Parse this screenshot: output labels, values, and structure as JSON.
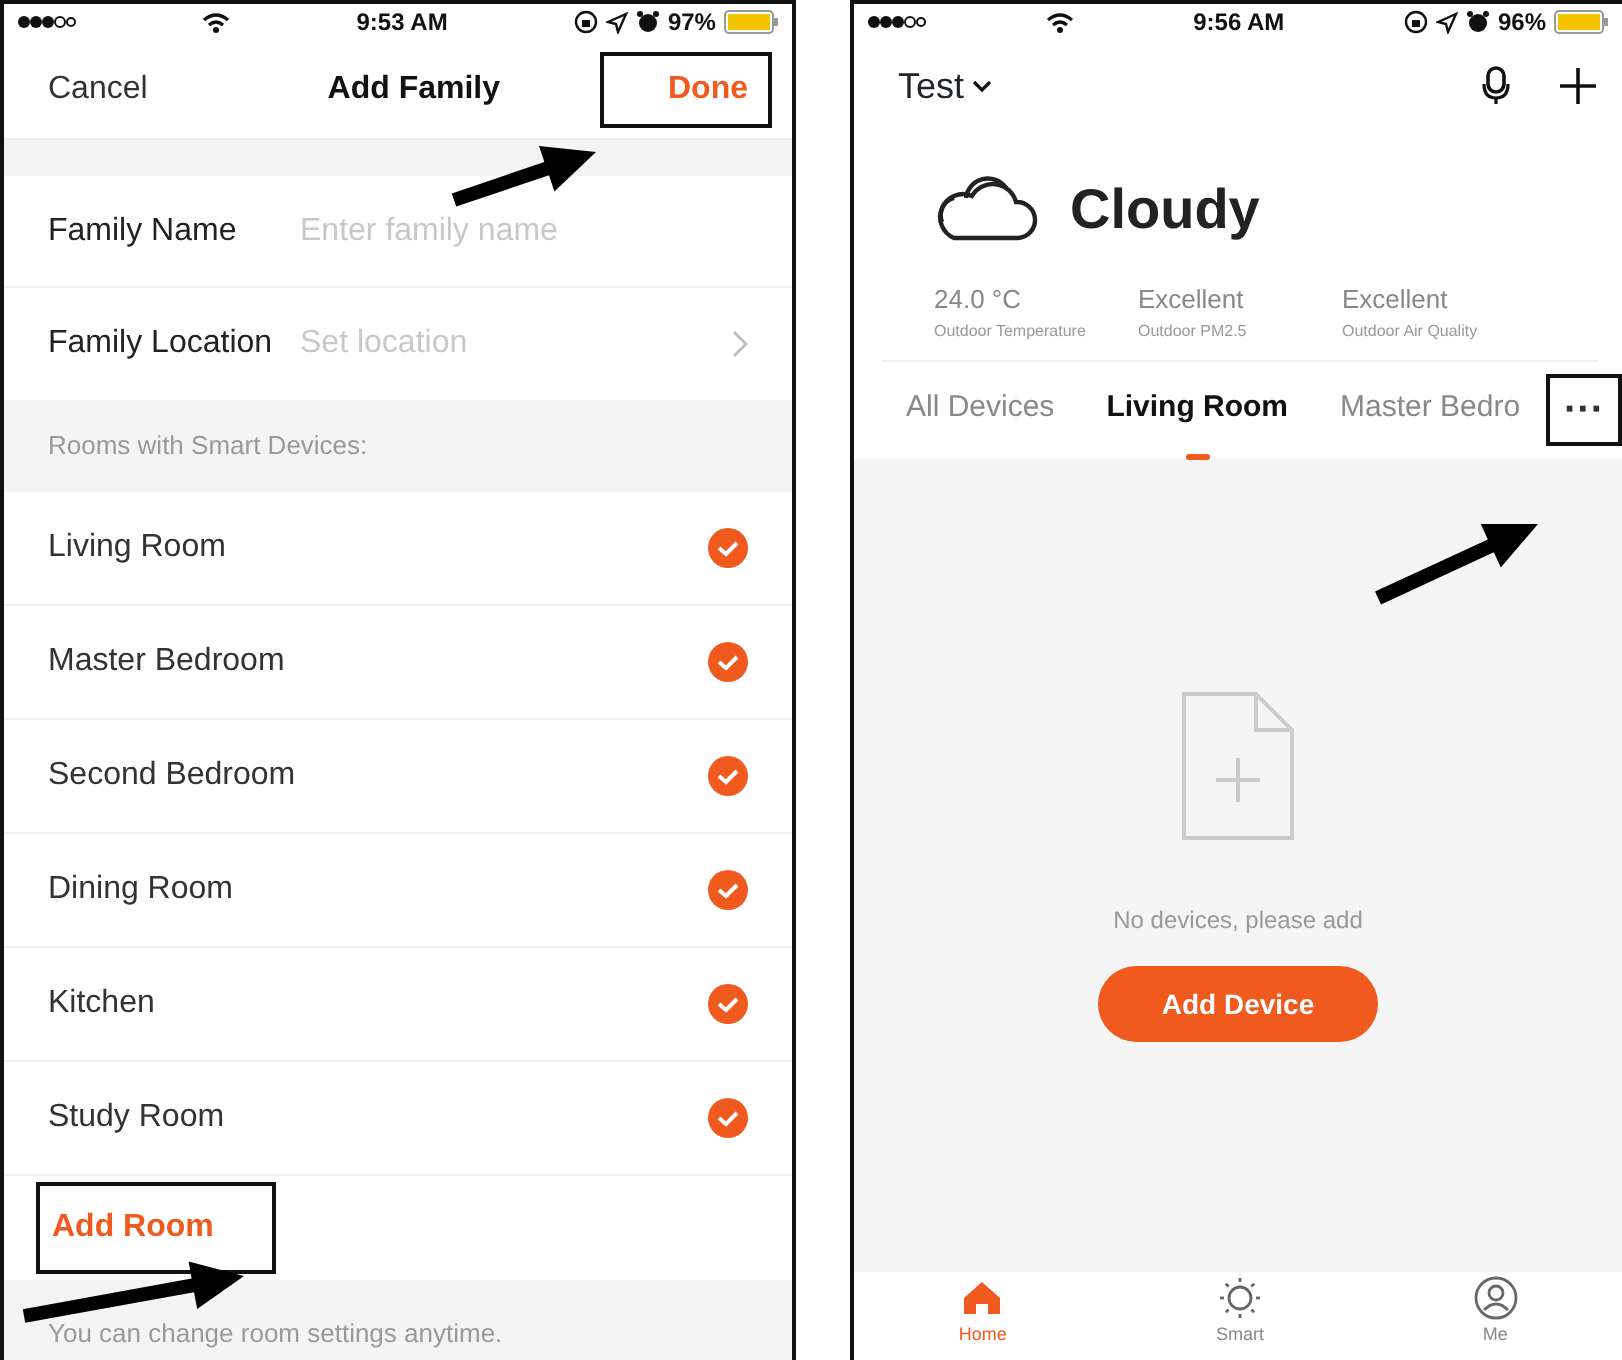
{
  "left_screen": {
    "status_bar": {
      "time": "9:53 AM",
      "battery": "97%"
    },
    "nav": {
      "cancel": "Cancel",
      "title": "Add Family",
      "done": {
        "label": "Done",
        "highlighted": true
      }
    },
    "form": [
      {
        "label": "Family Name",
        "placeholder": "Enter family name",
        "kind": "text"
      },
      {
        "label": "Family Location",
        "placeholder": "Set location",
        "kind": "select"
      }
    ],
    "rooms_header": "Rooms with Smart Devices:",
    "rooms": [
      {
        "name": "Living Room",
        "checked": true
      },
      {
        "name": "Master Bedroom",
        "checked": true
      },
      {
        "name": "Second Bedroom",
        "checked": true
      },
      {
        "name": "Dining Room",
        "checked": true
      },
      {
        "name": "Kitchen",
        "checked": true
      },
      {
        "name": "Study Room",
        "checked": true
      }
    ],
    "add_room": {
      "label": "Add Room",
      "highlighted": true
    },
    "footer": "You can change room settings anytime."
  },
  "right_screen": {
    "status_bar": {
      "time": "9:56 AM",
      "battery": "96%"
    },
    "home": "Test",
    "weather": {
      "condition": "Cloudy",
      "stats": [
        {
          "value": "24.0 °C",
          "label": "Outdoor Temperature"
        },
        {
          "value": "Excellent",
          "label": "Outdoor PM2.5"
        },
        {
          "value": "Excellent",
          "label": "Outdoor Air Quality"
        }
      ]
    },
    "room_tabs": [
      {
        "label": "All Devices",
        "selected": false
      },
      {
        "label": "Living Room",
        "selected": true
      },
      {
        "label": "Master Bedro",
        "selected": false
      }
    ],
    "more": {
      "label": "···",
      "highlighted": true
    },
    "empty": {
      "message": "No devices, please add",
      "button": "Add Device"
    },
    "tab_bar": [
      {
        "label": "Home",
        "kind": "home",
        "selected": true
      },
      {
        "label": "Smart",
        "kind": "smart",
        "selected": false
      },
      {
        "label": "Me",
        "kind": "me",
        "selected": false
      }
    ]
  }
}
